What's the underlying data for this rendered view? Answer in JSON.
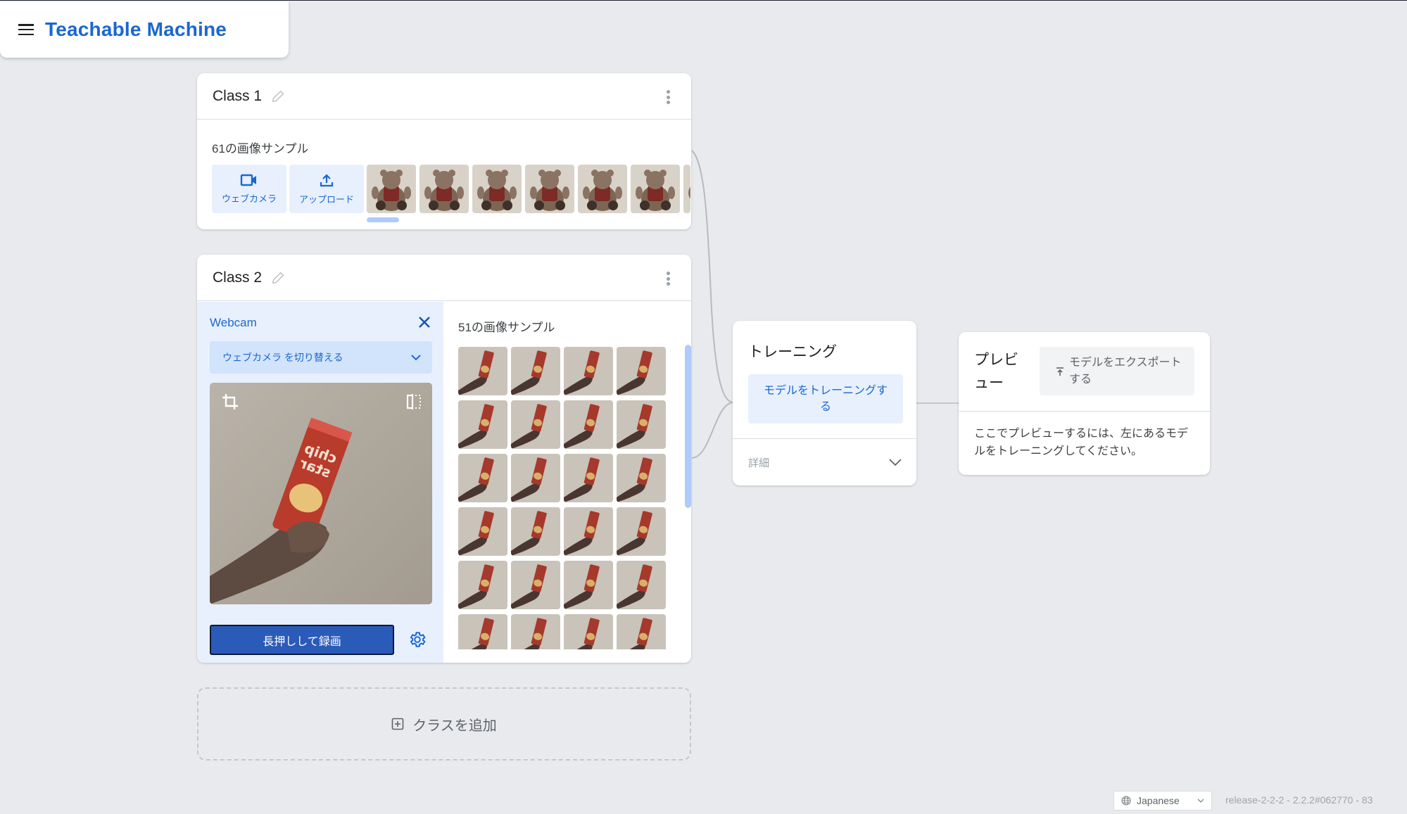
{
  "app": {
    "title": "Teachable Machine",
    "menu_icon": "hamburger-menu-icon"
  },
  "classes": [
    {
      "name": "Class 1",
      "sample_count_label": "61の画像サンプル",
      "sources": [
        {
          "label": "ウェブカメラ",
          "icon": "webcam-icon"
        },
        {
          "label": "アップロード",
          "icon": "upload-icon"
        }
      ],
      "visible_thumbnails": 7,
      "thumbnail_subject": "teddy bear"
    },
    {
      "name": "Class 2",
      "sample_count_label": "51の画像サンプル",
      "webcam": {
        "label": "Webcam",
        "switch_label": "ウェブカメラ を切り替える",
        "record_label": "長押しして録画"
      },
      "visible_thumbnails": 24,
      "thumbnail_subject": "chip star can held in hand"
    }
  ],
  "add_class": {
    "label": "クラスを追加"
  },
  "training": {
    "title": "トレーニング",
    "train_button": "モデルをトレーニングする",
    "details_label": "詳細"
  },
  "preview": {
    "title": "プレビュー",
    "export_button": "モデルをエクスポートする",
    "message": "ここでプレビューするには、左にあるモデルをトレーニングしてください。"
  },
  "footer": {
    "language": "Japanese",
    "version": "release-2-2-2 - 2.2.2#062770 - 83"
  },
  "colors": {
    "accent": "#1967d2",
    "background": "#e8eaed",
    "tint": "#e8f0fe",
    "record_button": "#2b5bb8"
  }
}
